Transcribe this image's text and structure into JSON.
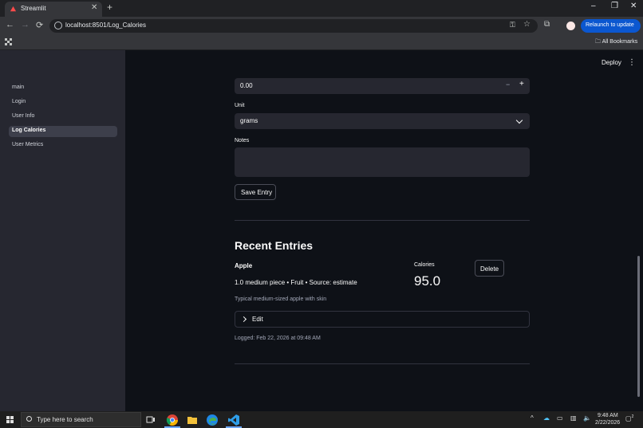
{
  "browser": {
    "tab_title": "Streamlit",
    "tab_close_glyph": "✕",
    "new_tab_glyph": "+",
    "url": "localhost:8501/Log_Calories",
    "relaunch_label": "Relaunch to update",
    "all_bookmarks_label": "All Bookmarks",
    "window_controls": [
      "–",
      "❐",
      "✕"
    ],
    "nav_glyphs": {
      "back": "←",
      "forward": "→",
      "reload": "⟳"
    }
  },
  "sidebar": {
    "items": [
      {
        "label": "main",
        "active": false
      },
      {
        "label": "Login",
        "active": false
      },
      {
        "label": "User Info",
        "active": false
      },
      {
        "label": "Log Calories",
        "active": true
      },
      {
        "label": "User Metrics",
        "active": false
      }
    ]
  },
  "header": {
    "deploy_label": "Deploy",
    "menu_glyph": "⋮"
  },
  "form": {
    "quantity_value": "0.00",
    "minus_glyph": "−",
    "plus_glyph": "+",
    "unit_label": "Unit",
    "unit_value": "grams",
    "notes_label": "Notes",
    "notes_value": "",
    "save_label": "Save Entry"
  },
  "recent": {
    "title": "Recent Entries",
    "entry": {
      "name": "Apple",
      "details": "1.0 medium piece • Fruit • Source: estimate",
      "description": "Typical medium-sized apple with skin",
      "calories_label": "Calories",
      "calories_value": "95.0",
      "delete_label": "Delete",
      "edit_label": "Edit",
      "logged": "Logged: Feb 22, 2026 at 09:48 AM"
    }
  },
  "taskbar": {
    "search_placeholder": "Type here to search",
    "time": "9:48 AM",
    "date": "2/22/2026",
    "notification_count": "2"
  },
  "colors": {
    "accent_blue": "#0b57d0",
    "streamlit_bg": "#0e1117",
    "sidebar_bg": "#262730",
    "input_bg": "#262730"
  }
}
